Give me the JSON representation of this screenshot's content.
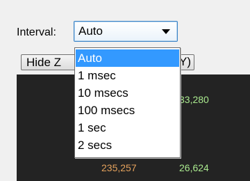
{
  "interval": {
    "label": "Interval:",
    "selected": "Auto",
    "options": [
      "Auto",
      "1 msec",
      "10 msecs",
      "100 msecs",
      "1 sec",
      "2 secs"
    ]
  },
  "buttons": {
    "hide_label": "Hide Z",
    "right_fragment": "Y)"
  },
  "panel_values": {
    "top_green": "33,280",
    "bottom_orange": "235,257",
    "bottom_green": "26,624"
  },
  "colors": {
    "dropdown_highlight": "#3399ff",
    "panel_background": "#232323",
    "green_text": "#a9e88e",
    "orange_text": "#e3a15c"
  },
  "icons": {
    "combo_arrow": "chevron-down-icon"
  }
}
